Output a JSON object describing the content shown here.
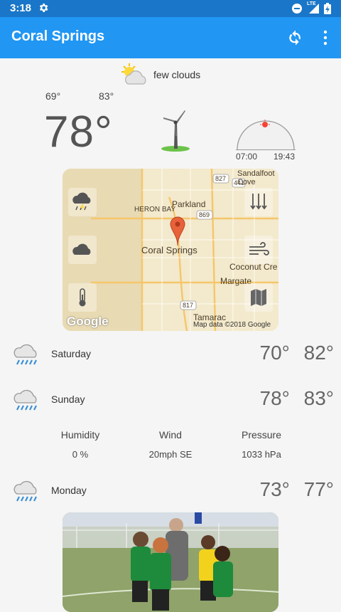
{
  "status_bar": {
    "time": "3:18",
    "icons": [
      "gear-icon",
      "do-not-disturb-icon",
      "lte-signal-icon",
      "battery-icon"
    ],
    "network_label": "LTE"
  },
  "app_bar": {
    "title": "Coral Springs",
    "actions": [
      "refresh-icon",
      "more-vert-icon"
    ]
  },
  "current": {
    "condition_icon": "partly-cloudy-icon",
    "condition": "few clouds",
    "low": "69°",
    "high": "83°",
    "temperature": "78°",
    "wind_icon": "wind-turbine-icon",
    "sunrise": "07:00",
    "sunset": "19:43"
  },
  "map": {
    "place_labels": [
      "Sandalfoot Cove",
      "Parkland",
      "HERON BAY",
      "Coral Springs",
      "Coconut Cre",
      "Margate",
      "Tamarac"
    ],
    "road_shields": [
      "827",
      "441",
      "869",
      "817"
    ],
    "layer_buttons": [
      "rain-layer-icon",
      "clouds-layer-icon",
      "temperature-layer-icon"
    ],
    "overlay_buttons": [
      "pressure-layer-icon",
      "wind-layer-icon",
      "map-layer-icon"
    ],
    "logo_text": "Google",
    "attribution": "Map data ©2018 Google"
  },
  "forecast": [
    {
      "day": "Saturday",
      "low": "70°",
      "high": "82°",
      "icon": "rain-cloud-icon"
    },
    {
      "day": "Sunday",
      "low": "78°",
      "high": "83°",
      "icon": "rain-cloud-icon"
    },
    {
      "day": "Monday",
      "low": "73°",
      "high": "77°",
      "icon": "rain-cloud-icon"
    }
  ],
  "details": {
    "humidity_label": "Humidity",
    "humidity_value": "0 %",
    "wind_label": "Wind",
    "wind_value": "20mph SE",
    "pressure_label": "Pressure",
    "pressure_value": "1033 hPa"
  },
  "colors": {
    "status_bar": "#1976c8",
    "app_bar": "#2196f3",
    "rain_blue": "#3a8fd6",
    "sun_dot": "#f44336"
  }
}
